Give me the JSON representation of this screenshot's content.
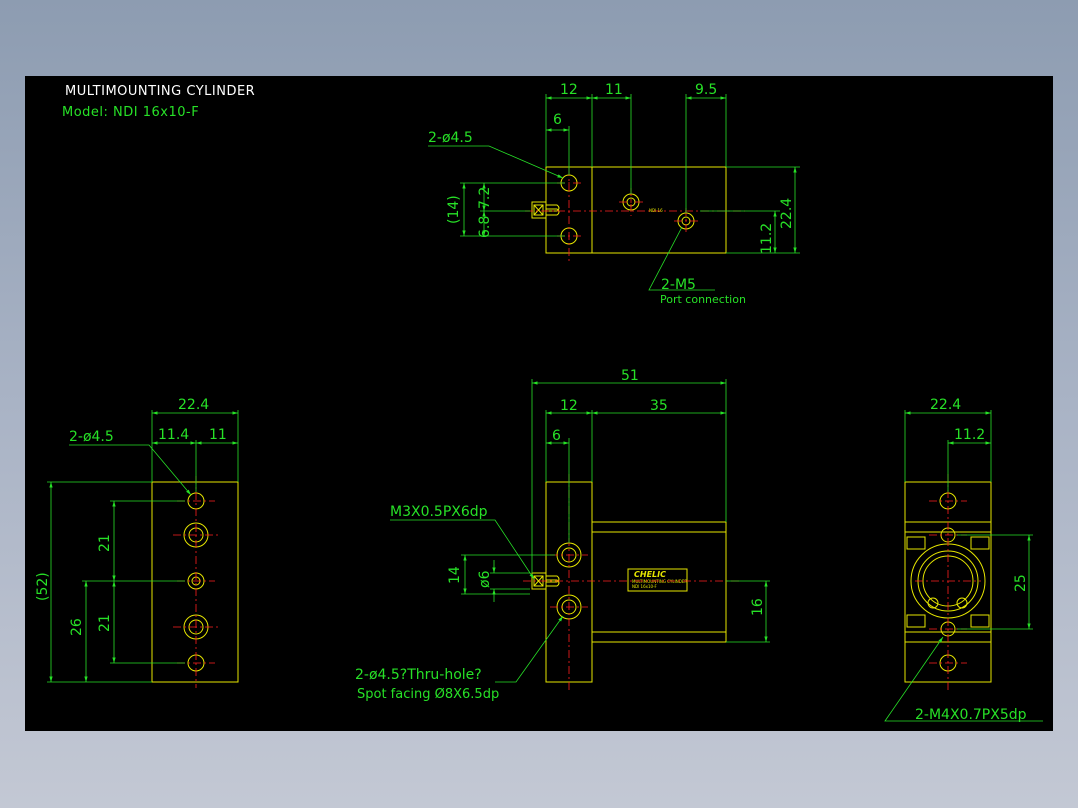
{
  "header": {
    "title": "MULTIMOUNTING CYLINDER",
    "model": "Model:  NDI 16x10-F"
  },
  "top_view": {
    "dims": {
      "d12": "12",
      "d11": "11",
      "d9_5": "9.5",
      "d6": "6",
      "d14": "(14)",
      "d6_8": "6.8",
      "d7_2": "7.2",
      "d11_2": "11.2",
      "d22_4": "22.4"
    },
    "callout_holes": "2-ø4.5",
    "callout_ports": "2-M5",
    "port_note": "Port connection",
    "body_label": "NDI 16"
  },
  "left_view": {
    "dims": {
      "d22_4": "22.4",
      "d11_4": "11.4",
      "d11": "11",
      "d52": "(52)",
      "d21a": "21",
      "d21b": "21",
      "d26": "26"
    },
    "callout_holes": "2-ø4.5"
  },
  "front_view": {
    "dims": {
      "d51": "51",
      "d12": "12",
      "d35": "35",
      "d6": "6",
      "d14": "14",
      "d6dia": "ø6",
      "d16": "16"
    },
    "callout_thread": "M3X0.5PX6dp",
    "callout_holes": "2-ø4.5?Thru-hole?",
    "callout_spot": "Spot facing  Ø8X6.5dp",
    "brand": "CHELIC",
    "brand_line1": "MULTIMOUNTING CYLINDER",
    "brand_line2": "NDI 16x10-F"
  },
  "right_view": {
    "dims": {
      "d22_4": "22.4",
      "d11_2": "11.2",
      "d25": "25"
    },
    "callout_thread": "2-M4X0.7PX5dp"
  },
  "colors": {
    "outline": "#e6e600",
    "dimension": "#27e127",
    "centerline": "#ff2020",
    "background": "#000000"
  }
}
